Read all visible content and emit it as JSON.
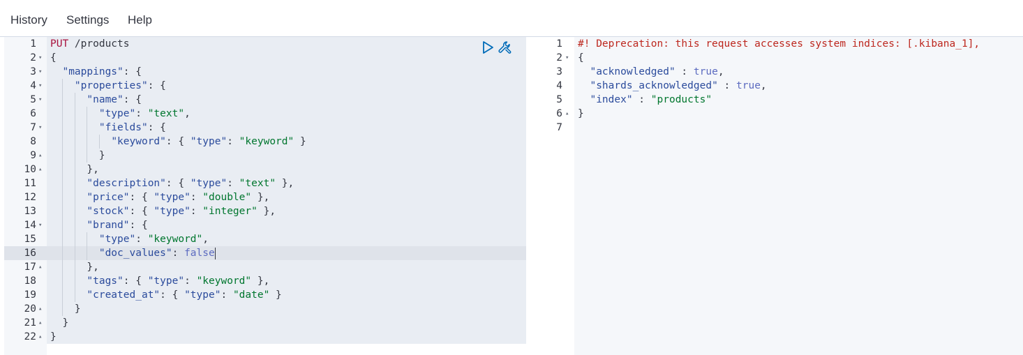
{
  "menu": {
    "items": [
      "History",
      "Settings",
      "Help"
    ]
  },
  "request": {
    "active_line": 16,
    "lines": [
      {
        "n": "1",
        "fold": "",
        "code": [
          [
            "k-method",
            "PUT"
          ],
          [
            "k-url",
            " /products"
          ]
        ]
      },
      {
        "n": "2",
        "fold": "down",
        "code": [
          [
            "k-punc",
            "{"
          ]
        ]
      },
      {
        "n": "3",
        "fold": "down",
        "code": [
          [
            "k-punc",
            "  "
          ],
          [
            "k-key",
            "\"mappings\""
          ],
          [
            "k-punc",
            ": {"
          ]
        ]
      },
      {
        "n": "4",
        "fold": "down",
        "code": [
          [
            "k-punc",
            "    "
          ],
          [
            "k-key",
            "\"properties\""
          ],
          [
            "k-punc",
            ": {"
          ]
        ]
      },
      {
        "n": "5",
        "fold": "down",
        "code": [
          [
            "k-punc",
            "      "
          ],
          [
            "k-key",
            "\"name\""
          ],
          [
            "k-punc",
            ": {"
          ]
        ]
      },
      {
        "n": "6",
        "fold": "",
        "code": [
          [
            "k-punc",
            "        "
          ],
          [
            "k-key",
            "\"type\""
          ],
          [
            "k-punc",
            ": "
          ],
          [
            "k-str",
            "\"text\""
          ],
          [
            "k-punc",
            ","
          ]
        ]
      },
      {
        "n": "7",
        "fold": "down",
        "code": [
          [
            "k-punc",
            "        "
          ],
          [
            "k-key",
            "\"fields\""
          ],
          [
            "k-punc",
            ": {"
          ]
        ]
      },
      {
        "n": "8",
        "fold": "",
        "code": [
          [
            "k-punc",
            "          "
          ],
          [
            "k-key",
            "\"keyword\""
          ],
          [
            "k-punc",
            ": { "
          ],
          [
            "k-key",
            "\"type\""
          ],
          [
            "k-punc",
            ": "
          ],
          [
            "k-str",
            "\"keyword\""
          ],
          [
            "k-punc",
            " }"
          ]
        ]
      },
      {
        "n": "9",
        "fold": "up",
        "code": [
          [
            "k-punc",
            "        }"
          ]
        ]
      },
      {
        "n": "10",
        "fold": "up",
        "code": [
          [
            "k-punc",
            "      },"
          ]
        ]
      },
      {
        "n": "11",
        "fold": "",
        "code": [
          [
            "k-punc",
            "      "
          ],
          [
            "k-key",
            "\"description\""
          ],
          [
            "k-punc",
            ": { "
          ],
          [
            "k-key",
            "\"type\""
          ],
          [
            "k-punc",
            ": "
          ],
          [
            "k-str",
            "\"text\""
          ],
          [
            "k-punc",
            " },"
          ]
        ]
      },
      {
        "n": "12",
        "fold": "",
        "code": [
          [
            "k-punc",
            "      "
          ],
          [
            "k-key",
            "\"price\""
          ],
          [
            "k-punc",
            ": { "
          ],
          [
            "k-key",
            "\"type\""
          ],
          [
            "k-punc",
            ": "
          ],
          [
            "k-str",
            "\"double\""
          ],
          [
            "k-punc",
            " },"
          ]
        ]
      },
      {
        "n": "13",
        "fold": "",
        "code": [
          [
            "k-punc",
            "      "
          ],
          [
            "k-key",
            "\"stock\""
          ],
          [
            "k-punc",
            ": { "
          ],
          [
            "k-key",
            "\"type\""
          ],
          [
            "k-punc",
            ": "
          ],
          [
            "k-str",
            "\"integer\""
          ],
          [
            "k-punc",
            " },"
          ]
        ]
      },
      {
        "n": "14",
        "fold": "down",
        "code": [
          [
            "k-punc",
            "      "
          ],
          [
            "k-key",
            "\"brand\""
          ],
          [
            "k-punc",
            ": {"
          ]
        ]
      },
      {
        "n": "15",
        "fold": "",
        "code": [
          [
            "k-punc",
            "        "
          ],
          [
            "k-key",
            "\"type\""
          ],
          [
            "k-punc",
            ": "
          ],
          [
            "k-str",
            "\"keyword\""
          ],
          [
            "k-punc",
            ","
          ]
        ]
      },
      {
        "n": "16",
        "fold": "",
        "code": [
          [
            "k-punc",
            "        "
          ],
          [
            "k-key",
            "\"doc_values\""
          ],
          [
            "k-punc",
            ": "
          ],
          [
            "k-bool",
            "false"
          ]
        ]
      },
      {
        "n": "17",
        "fold": "up",
        "code": [
          [
            "k-punc",
            "      },"
          ]
        ]
      },
      {
        "n": "18",
        "fold": "",
        "code": [
          [
            "k-punc",
            "      "
          ],
          [
            "k-key",
            "\"tags\""
          ],
          [
            "k-punc",
            ": { "
          ],
          [
            "k-key",
            "\"type\""
          ],
          [
            "k-punc",
            ": "
          ],
          [
            "k-str",
            "\"keyword\""
          ],
          [
            "k-punc",
            " },"
          ]
        ]
      },
      {
        "n": "19",
        "fold": "",
        "code": [
          [
            "k-punc",
            "      "
          ],
          [
            "k-key",
            "\"created_at\""
          ],
          [
            "k-punc",
            ": { "
          ],
          [
            "k-key",
            "\"type\""
          ],
          [
            "k-punc",
            ": "
          ],
          [
            "k-str",
            "\"date\""
          ],
          [
            "k-punc",
            " }"
          ]
        ]
      },
      {
        "n": "20",
        "fold": "up",
        "code": [
          [
            "k-punc",
            "    }"
          ]
        ]
      },
      {
        "n": "21",
        "fold": "up",
        "code": [
          [
            "k-punc",
            "  }"
          ]
        ]
      },
      {
        "n": "22",
        "fold": "up",
        "code": [
          [
            "k-punc",
            "}"
          ]
        ]
      }
    ]
  },
  "response": {
    "lines": [
      {
        "n": "1",
        "fold": "",
        "code": [
          [
            "k-warn",
            "#! Deprecation: this request accesses system indices: [.kibana_1],"
          ]
        ]
      },
      {
        "n": "2",
        "fold": "down",
        "code": [
          [
            "k-punc",
            "{"
          ]
        ]
      },
      {
        "n": "3",
        "fold": "",
        "code": [
          [
            "k-punc",
            "  "
          ],
          [
            "k-key",
            "\"acknowledged\""
          ],
          [
            "k-punc",
            " : "
          ],
          [
            "k-bool",
            "true"
          ],
          [
            "k-punc",
            ","
          ]
        ]
      },
      {
        "n": "4",
        "fold": "",
        "code": [
          [
            "k-punc",
            "  "
          ],
          [
            "k-key",
            "\"shards_acknowledged\""
          ],
          [
            "k-punc",
            " : "
          ],
          [
            "k-bool",
            "true"
          ],
          [
            "k-punc",
            ","
          ]
        ]
      },
      {
        "n": "5",
        "fold": "",
        "code": [
          [
            "k-punc",
            "  "
          ],
          [
            "k-key",
            "\"index\""
          ],
          [
            "k-punc",
            " : "
          ],
          [
            "k-str",
            "\"products\""
          ]
        ]
      },
      {
        "n": "6",
        "fold": "up",
        "code": [
          [
            "k-punc",
            "}"
          ]
        ]
      },
      {
        "n": "7",
        "fold": "",
        "code": []
      }
    ]
  },
  "icons": {
    "run": "play-icon",
    "settings": "wrench-icon"
  },
  "colors": {
    "method": "#a8123e",
    "key": "#2b4b9c",
    "string": "#00762e",
    "boolean": "#5c6bc0",
    "warning": "#bd271e",
    "run_icon": "#006bb8"
  }
}
